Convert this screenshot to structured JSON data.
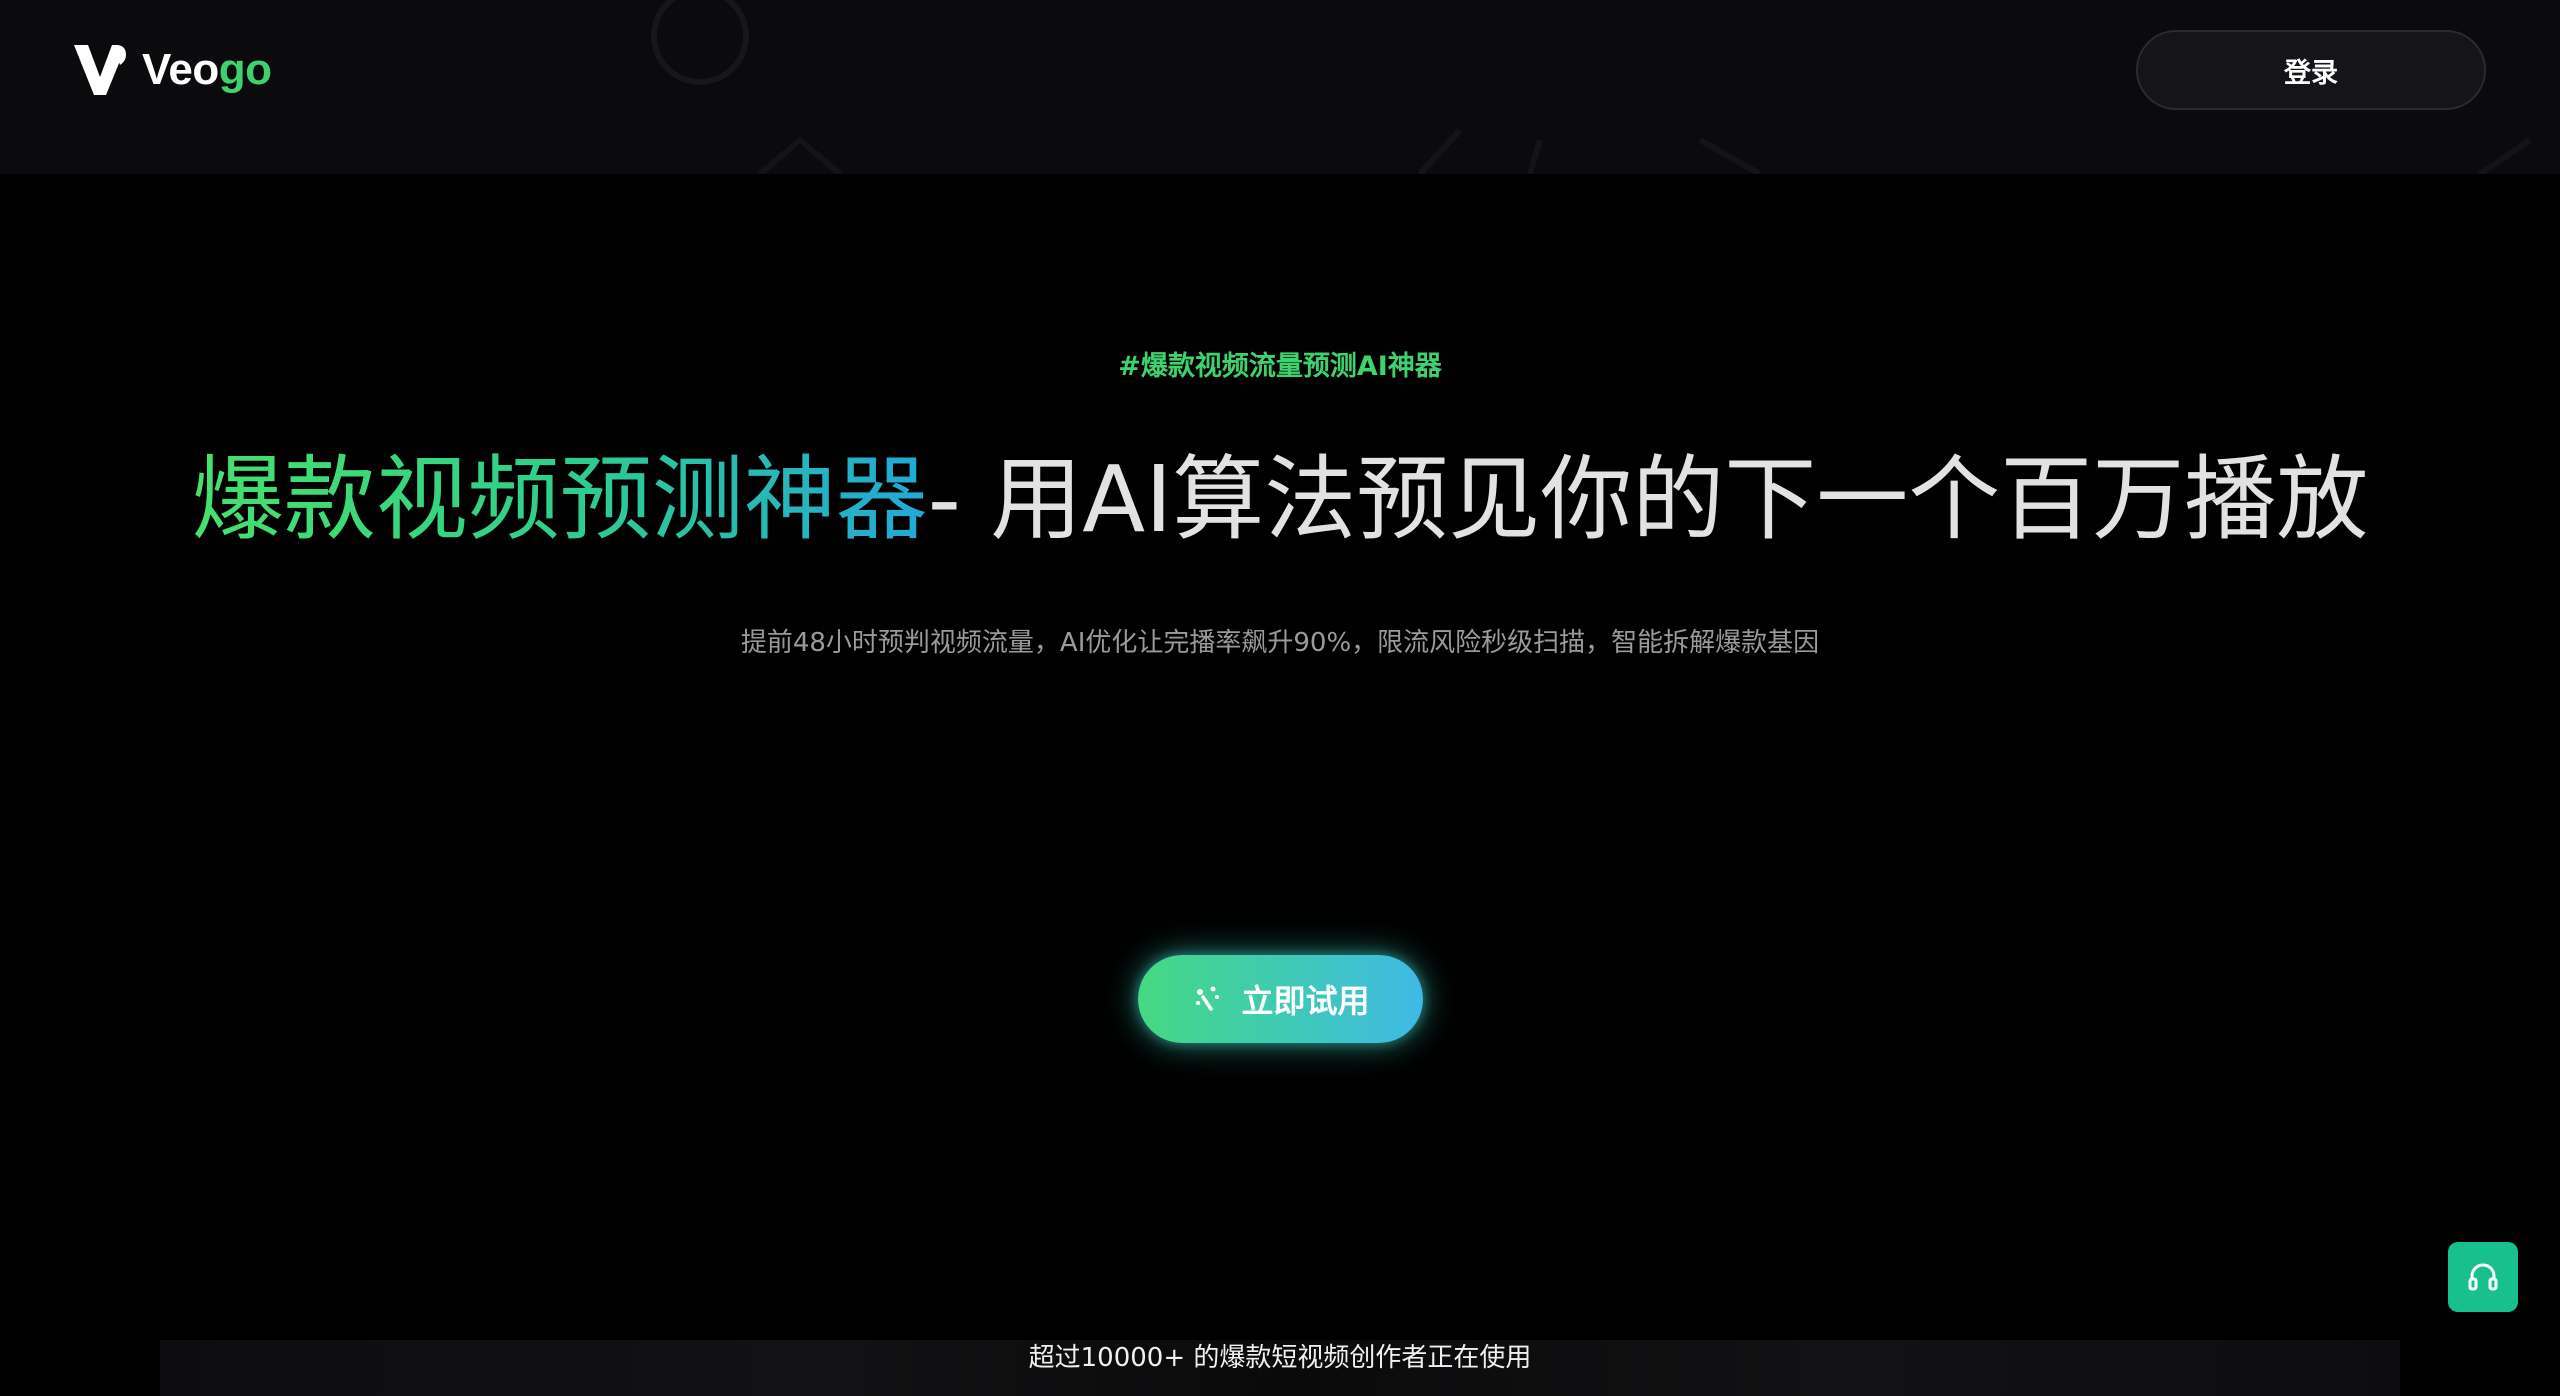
{
  "header": {
    "logo": {
      "text_primary": "Veo",
      "text_accent": "go"
    },
    "login_label": "登录"
  },
  "hero": {
    "tagline": "#爆款视频流量预测AI神器",
    "headline_highlight": "爆款视频预测神器",
    "headline_rest": "- 用AI算法预见你的下一个百万播放",
    "subtitle": "提前48小时预判视频流量，AI优化让完播率飙升90%，限流风险秒级扫描，智能拆解爆款基因",
    "cta_label": "立即试用"
  },
  "footer": {
    "users_text": "超过10000+ 的爆款短视频创作者正在使用"
  },
  "icons": {
    "cta_icon": "sparkle-icon",
    "support_icon": "headset-icon"
  },
  "colors": {
    "accent_green": "#3ed26e",
    "accent_blue": "#40b9e6",
    "support_teal": "#19c08f"
  }
}
